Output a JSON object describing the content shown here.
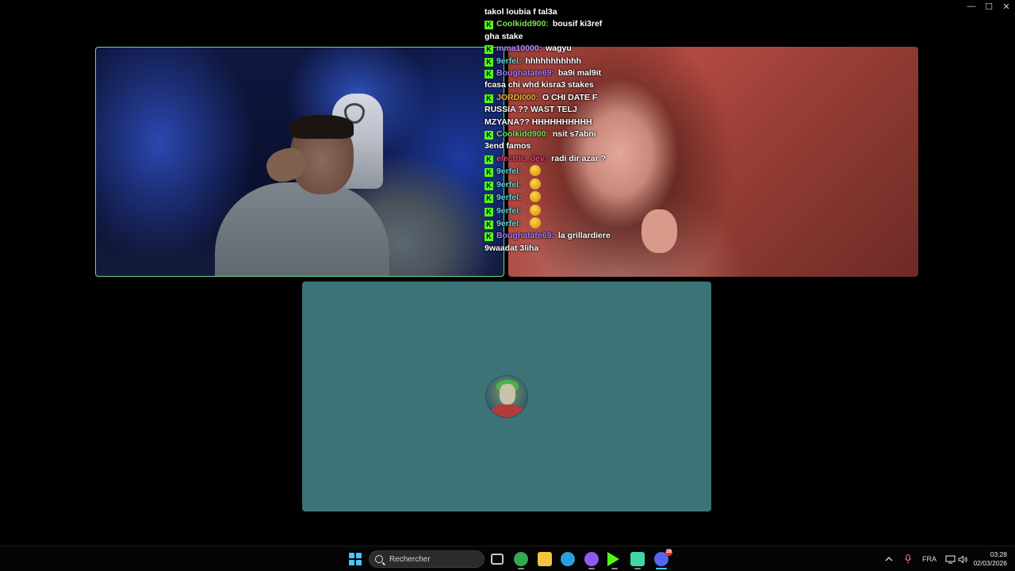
{
  "window_controls": {
    "minimize": "—",
    "maximize": "☐",
    "close": "✕"
  },
  "chat": {
    "messages": [
      {
        "user": "",
        "user_color": "",
        "text": "takol loubia f tal3a",
        "emotes": 0
      },
      {
        "user": "Coolkidd900:",
        "user_color": "#7ee05a",
        "text": "bousif ki3ref",
        "emotes": 0
      },
      {
        "user": "",
        "user_color": "",
        "text": "gha stake",
        "emotes": 0
      },
      {
        "user": "mma10000:",
        "user_color": "#b58cff",
        "text": "wagyu",
        "emotes": 0
      },
      {
        "user": "9erfel:",
        "user_color": "#5fd7e0",
        "text": "hhhhhhhhhhh",
        "emotes": 0
      },
      {
        "user": "Boughatate69:",
        "user_color": "#a77cff",
        "text": "ba9i mal9it",
        "emotes": 0
      },
      {
        "user": "",
        "user_color": "",
        "text": "fcasa chi whd kisra3 stakes",
        "emotes": 0
      },
      {
        "user": "JORDI000:",
        "user_color": "#f0b232",
        "text": "O CHI DATE F",
        "emotes": 0
      },
      {
        "user": "",
        "user_color": "",
        "text": "RUSSIA ?? WAST TELJ",
        "emotes": 0
      },
      {
        "user": "",
        "user_color": "",
        "text": "MZYANA?? HHHHHHHHHH",
        "emotes": 0
      },
      {
        "user": "Coolkidd900:",
        "user_color": "#7ee05a",
        "text": "nsit s7abni",
        "emotes": 0
      },
      {
        "user": "",
        "user_color": "",
        "text": "3end famos",
        "emotes": 0
      },
      {
        "user": "electric_dev:",
        "user_color": "#e0447a",
        "text": "radi dir azar ?",
        "emotes": 0
      },
      {
        "user": "9erfel:",
        "user_color": "#5fd7e0",
        "text": "",
        "emotes": 1
      },
      {
        "user": "9erfel:",
        "user_color": "#5fd7e0",
        "text": "",
        "emotes": 1
      },
      {
        "user": "9erfel:",
        "user_color": "#5fd7e0",
        "text": "",
        "emotes": 1
      },
      {
        "user": "9erfel:",
        "user_color": "#5fd7e0",
        "text": "",
        "emotes": 1
      },
      {
        "user": "9erfel:",
        "user_color": "#5fd7e0",
        "text": "",
        "emotes": 1
      },
      {
        "user": "Boughatate69:",
        "user_color": "#a77cff",
        "text": "la grillardiere",
        "emotes": 0
      },
      {
        "user": "",
        "user_color": "",
        "text": "9waadat 3liha",
        "emotes": 0
      }
    ]
  },
  "taskbar": {
    "search_placeholder": "Rechercher",
    "apps": [
      {
        "icon": "task-view-icon",
        "color": "#c9c9c9"
      },
      {
        "icon": "chrome-icon",
        "color": "#34a853"
      },
      {
        "icon": "file-explorer-icon",
        "color": "#f5c242"
      },
      {
        "icon": "edge-icon",
        "color": "#2b9fe0"
      },
      {
        "icon": "streamlabs-icon",
        "color": "#8a5cf6"
      },
      {
        "icon": "kick-icon",
        "color": "#53fc18"
      },
      {
        "icon": "copilot-icon",
        "color": "#3fd6a8"
      },
      {
        "icon": "discord-icon",
        "color": "#5865f2"
      }
    ],
    "discord_badge": "28",
    "language": "FRA",
    "time": "03:28",
    "date": "02/03/2026"
  }
}
